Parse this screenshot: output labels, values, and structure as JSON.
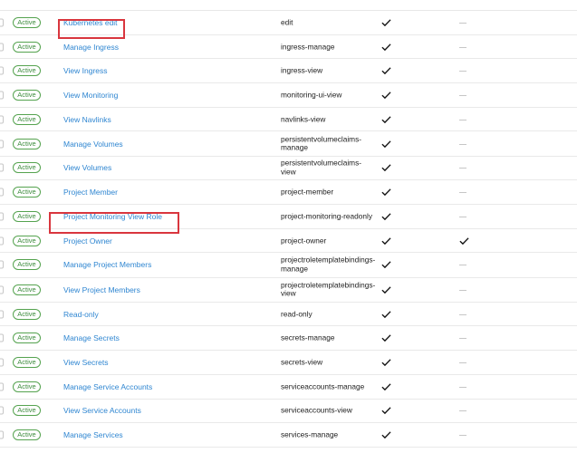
{
  "roles": [
    {
      "status": "Active",
      "name": "Kubernetes edit",
      "id": "edit",
      "col4": true,
      "col5": "—"
    },
    {
      "status": "Active",
      "name": "Manage Ingress",
      "id": "ingress-manage",
      "col4": true,
      "col5": "—"
    },
    {
      "status": "Active",
      "name": "View Ingress",
      "id": "ingress-view",
      "col4": true,
      "col5": "—"
    },
    {
      "status": "Active",
      "name": "View Monitoring",
      "id": "monitoring-ui-view",
      "col4": true,
      "col5": "—"
    },
    {
      "status": "Active",
      "name": "View Navlinks",
      "id": "navlinks-view",
      "col4": true,
      "col5": "—"
    },
    {
      "status": "Active",
      "name": "Manage Volumes",
      "id": "persistentvolumeclaims-manage",
      "col4": true,
      "col5": "—"
    },
    {
      "status": "Active",
      "name": "View Volumes",
      "id": "persistentvolumeclaims-view",
      "col4": true,
      "col5": "—"
    },
    {
      "status": "Active",
      "name": "Project Member",
      "id": "project-member",
      "col4": true,
      "col5": "—"
    },
    {
      "status": "Active",
      "name": "Project Monitoring View Role",
      "id": "project-monitoring-readonly",
      "col4": true,
      "col5": "—"
    },
    {
      "status": "Active",
      "name": "Project Owner",
      "id": "project-owner",
      "col4": true,
      "col5": "check"
    },
    {
      "status": "Active",
      "name": "Manage Project Members",
      "id": "projectroletemplatebindings-manage",
      "col4": true,
      "col5": "—"
    },
    {
      "status": "Active",
      "name": "View Project Members",
      "id": "projectroletemplatebindings-view",
      "col4": true,
      "col5": "—"
    },
    {
      "status": "Active",
      "name": "Read-only",
      "id": "read-only",
      "col4": true,
      "col5": "—"
    },
    {
      "status": "Active",
      "name": "Manage Secrets",
      "id": "secrets-manage",
      "col4": true,
      "col5": "—"
    },
    {
      "status": "Active",
      "name": "View Secrets",
      "id": "secrets-view",
      "col4": true,
      "col5": "—"
    },
    {
      "status": "Active",
      "name": "Manage Service Accounts",
      "id": "serviceaccounts-manage",
      "col4": true,
      "col5": "—"
    },
    {
      "status": "Active",
      "name": "View Service Accounts",
      "id": "serviceaccounts-view",
      "col4": true,
      "col5": "—"
    },
    {
      "status": "Active",
      "name": "Manage Services",
      "id": "services-manage",
      "col4": true,
      "col5": "—"
    }
  ],
  "colors": {
    "active_badge": "#55a34f",
    "link": "#2f86d1",
    "highlight": "#d9363e"
  },
  "icons": {
    "checkbox": "checkbox-icon",
    "check": "check-icon"
  }
}
